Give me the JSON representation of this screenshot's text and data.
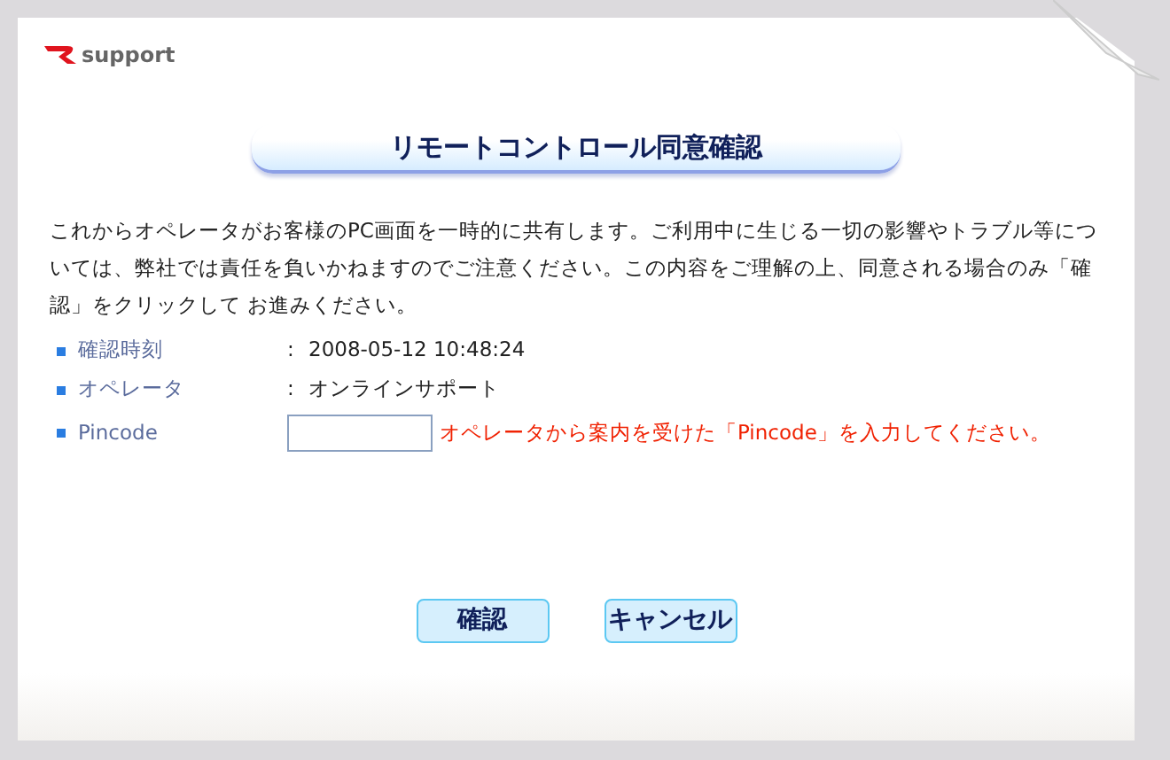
{
  "logo": {
    "text": "support"
  },
  "title": "リモートコントロール同意確認",
  "notice": "これからオペレータがお客様のPC画面を一時的に共有します。ご利用中に生じる一切の影響やトラブル等については、弊社では責任を負いかねますのでご注意ください。この内容をご理解の上、同意される場合のみ「確認」をクリックして お進みください。",
  "fields": [
    {
      "kind": "text",
      "label": "確認時刻",
      "separator": ":",
      "value": "2008-05-12 10:48:24"
    },
    {
      "kind": "text",
      "label": "オペレータ",
      "separator": ":",
      "value": "オンラインサポート"
    },
    {
      "kind": "input",
      "label": "Pincode",
      "hint": "オペレータから案内を受けた「Pincode」を入力してください。"
    }
  ],
  "buttons": [
    "確認",
    "キャンセル"
  ]
}
